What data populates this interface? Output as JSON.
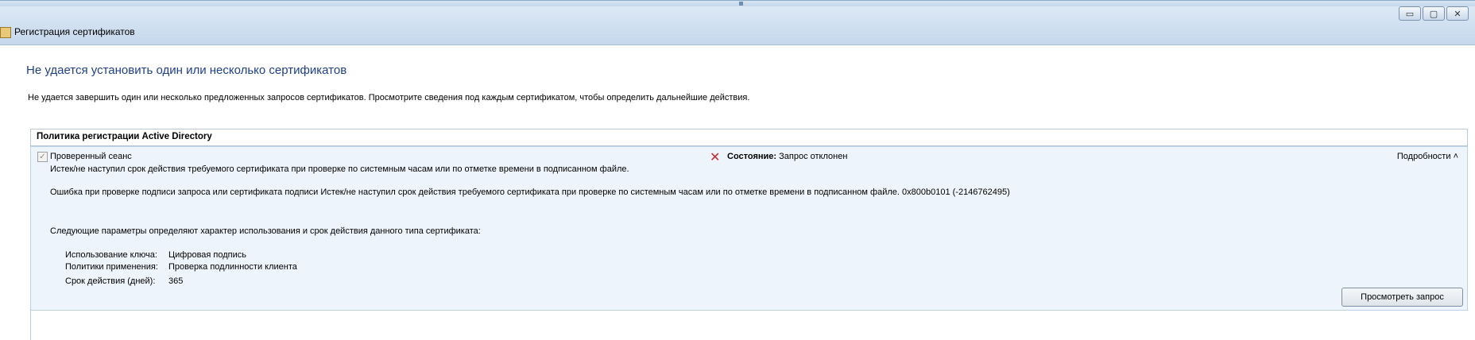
{
  "window": {
    "title": "Регистрация сертификатов",
    "controls": [
      "▭",
      "▢",
      "✕"
    ]
  },
  "main": {
    "headline": "Не удается установить один или несколько сертификатов",
    "description": "Не удается завершить один или несколько предложенных запросов сертификатов. Просмотрите сведения под каждым сертификатом, чтобы определить дальнейшие действия."
  },
  "policy": {
    "header": "Политика регистрации Active Directory",
    "item": {
      "name": "Проверенный сеанс",
      "status_label": "Состояние:",
      "status_value": "Запрос отклонен",
      "details_label": "Подробности",
      "error_short": "Истек/не наступил срок действия требуемого сертификата при проверке по системным часам или по отметке времени в подписанном файле.",
      "error_long": "Ошибка при проверке подписи запроса или сертификата подписи  Истек/не наступил срок действия требуемого сертификата при проверке по системным часам или по отметке времени в подписанном файле. 0x800b0101 (-2146762495)",
      "params_intro": "Следующие параметры определяют характер использования и срок действия данного типа сертификата:",
      "params": [
        {
          "label": "Использование ключа:",
          "value": "Цифровая подпись"
        },
        {
          "label": "Политики применения:",
          "value": "Проверка подлинности клиента"
        },
        {
          "label": "Срок действия (дней):",
          "value": "365"
        }
      ],
      "view_button": "Просмотреть запрос"
    }
  },
  "colors": {
    "headline": "#1e3f8a",
    "panel_bg": "#eef4fb",
    "error_icon": "#c0282d"
  }
}
